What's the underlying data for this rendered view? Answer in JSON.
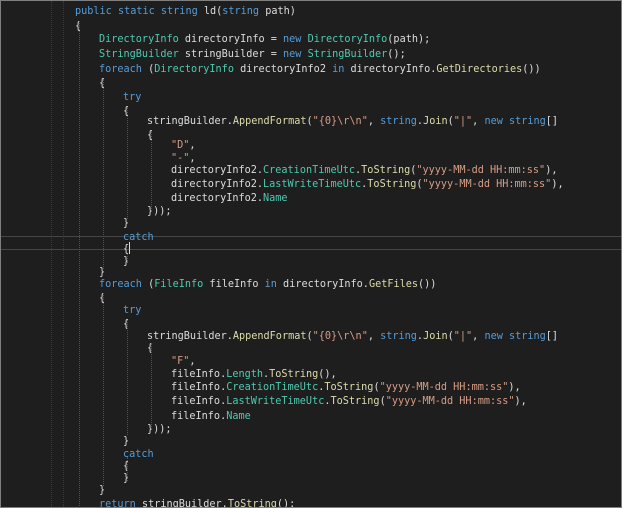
{
  "editor": {
    "lines": [
      [
        {
          "t": "public",
          "c": "kw"
        },
        {
          "t": " "
        },
        {
          "t": "static",
          "c": "kw"
        },
        {
          "t": " "
        },
        {
          "t": "string",
          "c": "kw"
        },
        {
          "t": " ld(",
          "c": "pn"
        },
        {
          "t": "string",
          "c": "kw"
        },
        {
          "t": " path)"
        }
      ],
      [
        {
          "t": "{"
        }
      ],
      [
        {
          "t": "DirectoryInfo",
          "c": "ty"
        },
        {
          "t": " directoryInfo = "
        },
        {
          "t": "new",
          "c": "kw"
        },
        {
          "t": " "
        },
        {
          "t": "DirectoryInfo",
          "c": "ty"
        },
        {
          "t": "(path);"
        }
      ],
      [
        {
          "t": "StringBuilder",
          "c": "ty"
        },
        {
          "t": " stringBuilder = "
        },
        {
          "t": "new",
          "c": "kw"
        },
        {
          "t": " "
        },
        {
          "t": "StringBuilder",
          "c": "ty"
        },
        {
          "t": "();"
        }
      ],
      [
        {
          "t": "foreach",
          "c": "kw"
        },
        {
          "t": " ("
        },
        {
          "t": "DirectoryInfo",
          "c": "ty"
        },
        {
          "t": " directoryInfo2 "
        },
        {
          "t": "in",
          "c": "kw"
        },
        {
          "t": " directoryInfo."
        },
        {
          "t": "GetDirectories",
          "c": "mt"
        },
        {
          "t": "())"
        }
      ],
      [
        {
          "t": "{"
        }
      ],
      [
        {
          "t": "try",
          "c": "kw"
        }
      ],
      [
        {
          "t": "{"
        }
      ],
      [
        {
          "t": "stringBuilder."
        },
        {
          "t": "AppendFormat",
          "c": "mt"
        },
        {
          "t": "("
        },
        {
          "t": "\"{0}\\r\\n\"",
          "c": "st"
        },
        {
          "t": ", "
        },
        {
          "t": "string",
          "c": "kw"
        },
        {
          "t": "."
        },
        {
          "t": "Join",
          "c": "mt"
        },
        {
          "t": "("
        },
        {
          "t": "\"|\"",
          "c": "st"
        },
        {
          "t": ", "
        },
        {
          "t": "new",
          "c": "kw"
        },
        {
          "t": " "
        },
        {
          "t": "string",
          "c": "kw"
        },
        {
          "t": "[]"
        }
      ],
      [
        {
          "t": "{"
        }
      ],
      [
        {
          "t": "\"D\"",
          "c": "st"
        },
        {
          "t": ","
        }
      ],
      [
        {
          "t": "\"-\"",
          "c": "st"
        },
        {
          "t": ","
        }
      ],
      [
        {
          "t": "directoryInfo2."
        },
        {
          "t": "CreationTimeUtc",
          "c": "ty"
        },
        {
          "t": "."
        },
        {
          "t": "ToString",
          "c": "mt"
        },
        {
          "t": "("
        },
        {
          "t": "\"yyyy-MM-dd HH:mm:ss\"",
          "c": "st"
        },
        {
          "t": "),"
        }
      ],
      [
        {
          "t": "directoryInfo2."
        },
        {
          "t": "LastWriteTimeUtc",
          "c": "ty"
        },
        {
          "t": "."
        },
        {
          "t": "ToString",
          "c": "mt"
        },
        {
          "t": "("
        },
        {
          "t": "\"yyyy-MM-dd HH:mm:ss\"",
          "c": "st"
        },
        {
          "t": "),"
        }
      ],
      [
        {
          "t": "directoryInfo2."
        },
        {
          "t": "Name",
          "c": "ty"
        }
      ],
      [
        {
          "t": "}));"
        }
      ],
      [
        {
          "t": "}"
        }
      ],
      [
        {
          "t": "catch",
          "c": "kw"
        }
      ],
      [
        {
          "t": "{"
        }
      ],
      [
        {
          "t": "}"
        }
      ],
      [
        {
          "t": "}"
        }
      ],
      [
        {
          "t": "foreach",
          "c": "kw"
        },
        {
          "t": " ("
        },
        {
          "t": "FileInfo",
          "c": "ty"
        },
        {
          "t": " fileInfo "
        },
        {
          "t": "in",
          "c": "kw"
        },
        {
          "t": " directoryInfo."
        },
        {
          "t": "GetFiles",
          "c": "mt"
        },
        {
          "t": "())"
        }
      ],
      [
        {
          "t": "{"
        }
      ],
      [
        {
          "t": "try",
          "c": "kw"
        }
      ],
      [
        {
          "t": "{"
        }
      ],
      [
        {
          "t": "stringBuilder."
        },
        {
          "t": "AppendFormat",
          "c": "mt"
        },
        {
          "t": "("
        },
        {
          "t": "\"{0}\\r\\n\"",
          "c": "st"
        },
        {
          "t": ", "
        },
        {
          "t": "string",
          "c": "kw"
        },
        {
          "t": "."
        },
        {
          "t": "Join",
          "c": "mt"
        },
        {
          "t": "("
        },
        {
          "t": "\"|\"",
          "c": "st"
        },
        {
          "t": ", "
        },
        {
          "t": "new",
          "c": "kw"
        },
        {
          "t": " "
        },
        {
          "t": "string",
          "c": "kw"
        },
        {
          "t": "[]"
        }
      ],
      [
        {
          "t": "{"
        }
      ],
      [
        {
          "t": "\"F\"",
          "c": "st"
        },
        {
          "t": ","
        }
      ],
      [
        {
          "t": "fileInfo."
        },
        {
          "t": "Length",
          "c": "ty"
        },
        {
          "t": "."
        },
        {
          "t": "ToString",
          "c": "mt"
        },
        {
          "t": "(),"
        }
      ],
      [
        {
          "t": "fileInfo."
        },
        {
          "t": "CreationTimeUtc",
          "c": "ty"
        },
        {
          "t": "."
        },
        {
          "t": "ToString",
          "c": "mt"
        },
        {
          "t": "("
        },
        {
          "t": "\"yyyy-MM-dd HH:mm:ss\"",
          "c": "st"
        },
        {
          "t": "),"
        }
      ],
      [
        {
          "t": "fileInfo."
        },
        {
          "t": "LastWriteTimeUtc",
          "c": "ty"
        },
        {
          "t": "."
        },
        {
          "t": "ToString",
          "c": "mt"
        },
        {
          "t": "("
        },
        {
          "t": "\"yyyy-MM-dd HH:mm:ss\"",
          "c": "st"
        },
        {
          "t": "),"
        }
      ],
      [
        {
          "t": "fileInfo."
        },
        {
          "t": "Name",
          "c": "ty"
        }
      ],
      [
        {
          "t": "}));"
        }
      ],
      [
        {
          "t": "}"
        }
      ],
      [
        {
          "t": "catch",
          "c": "kw"
        }
      ],
      [
        {
          "t": "{"
        }
      ],
      [
        {
          "t": "}"
        }
      ],
      [
        {
          "t": "}"
        }
      ],
      [
        {
          "t": "return",
          "c": "kw"
        },
        {
          "t": " stringBuilder."
        },
        {
          "t": "ToString",
          "c": "mt"
        },
        {
          "t": "();"
        }
      ],
      [
        {
          "t": "}"
        }
      ]
    ]
  },
  "colors": {
    "background": "#1e1e1e",
    "keyword": "#569cd6",
    "type": "#4ec9b0",
    "method": "#dcdcaa",
    "string": "#d69d85",
    "text": "#dcdcdc"
  }
}
